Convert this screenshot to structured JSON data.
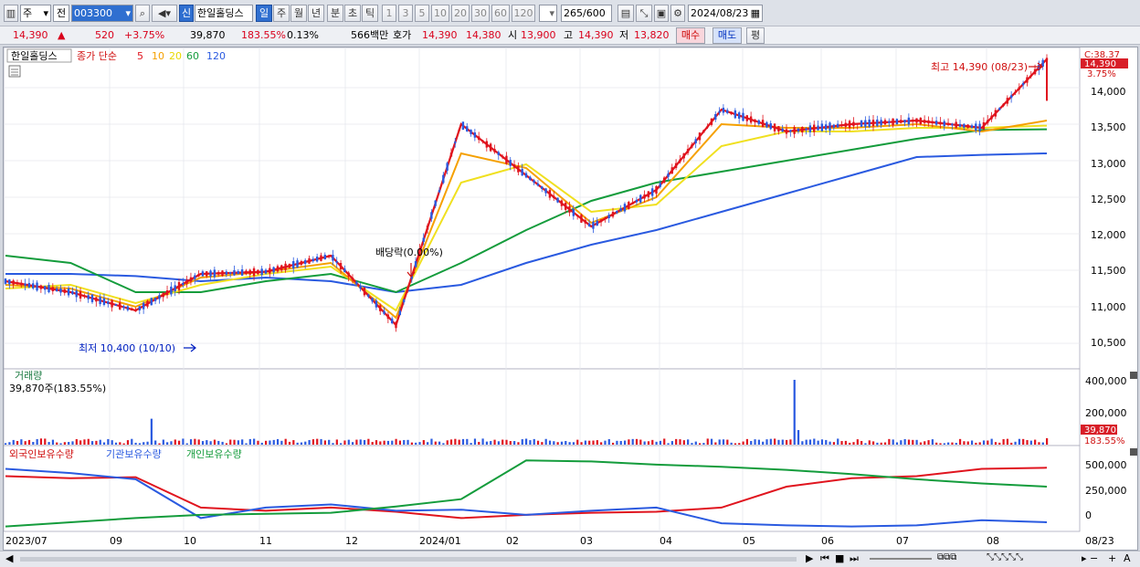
{
  "toolbar": {
    "period_unit": "주",
    "prev_label": "전",
    "stock_code": "003300",
    "new_badge": "신",
    "stock_name": "한일홀딩스",
    "timeframes": [
      "일",
      "주",
      "월",
      "년",
      "분",
      "초",
      "틱"
    ],
    "active_timeframe": "일",
    "intervals": [
      "1",
      "3",
      "5",
      "10",
      "20",
      "30",
      "60",
      "120"
    ],
    "count_current": "265",
    "count_total": "/600",
    "date": "2024/08/23"
  },
  "quote": {
    "price": "14,390",
    "change_arrow": "▲",
    "change": "520",
    "change_pct": "+3.75%",
    "volume": "39,870",
    "volume_ratio": "183.55%",
    "turnover_pct": "0.13%",
    "trade_value": "566백만",
    "bidask_label": "호가",
    "ask": "14,390",
    "bid": "14,380",
    "open_label": "시",
    "open": "13,900",
    "high_label": "고",
    "high": "14,390",
    "low_label": "저",
    "low": "13,820",
    "buy_button": "매수",
    "sell_button": "매도",
    "eval_button": "평"
  },
  "price_panel": {
    "stock_label": "한일홀딩스",
    "ma_title": "종가 단순",
    "ma_periods": [
      "5",
      "10",
      "20",
      "60",
      "120"
    ],
    "ma_colors": [
      "#e0141e",
      "#f5a000",
      "#f0e020",
      "#149c3c",
      "#2a5ae0"
    ],
    "y_ticks": [
      "14,000",
      "13,500",
      "13,000",
      "12,500",
      "12,000",
      "11,500",
      "11,000",
      "10,500"
    ],
    "ceiling_label": "C:38.37",
    "price_tag": "14,390",
    "pct_tag": "3.75%",
    "high_annotation": "최고 14,390 (08/23)",
    "low_annotation": "최저 10,400 (10/10)",
    "dividend_annotation": "배당락(0.00%)"
  },
  "volume_panel": {
    "title": "거래량",
    "value_label": "39,870주(183.55%)",
    "y_ticks": [
      "400,000",
      "200,000"
    ],
    "value_tag": "39,870",
    "pct_tag": "183.55%"
  },
  "holdings_panel": {
    "legend": [
      "외국인보유수량",
      "기관보유수량",
      "개인보유수량"
    ],
    "legend_colors": [
      "#e0141e",
      "#2a5ae0",
      "#149c3c"
    ],
    "y_ticks": [
      "500,000",
      "250,000",
      "0"
    ]
  },
  "x_axis": {
    "labels": [
      "2023/07",
      "09",
      "10",
      "11",
      "12",
      "2024/01",
      "02",
      "03",
      "04",
      "05",
      "06",
      "07",
      "08"
    ],
    "right_label": "08/23"
  },
  "chart_data": {
    "type": "line",
    "price_ylim": [
      10200,
      14500
    ],
    "price_ma": [
      {
        "name": "5",
        "x": [
          0,
          10,
          20,
          30,
          40,
          50,
          60,
          70,
          80,
          90,
          100
        ],
        "values": [
          11350,
          11200,
          10950,
          11450,
          11480,
          11700,
          10750,
          13500,
          12800,
          12100,
          12600,
          13700,
          13400,
          13500,
          13550,
          13450,
          14390
        ]
      },
      {
        "name": "10",
        "values": [
          11300,
          11250,
          11000,
          11400,
          11480,
          11600,
          10850,
          13100,
          12900,
          12150,
          12500,
          13500,
          13450,
          13450,
          13500,
          13400,
          13550
        ]
      },
      {
        "name": "20",
        "values": [
          11250,
          11300,
          11050,
          11300,
          11450,
          11550,
          10950,
          12700,
          12950,
          12300,
          12400,
          13200,
          13400,
          13400,
          13450,
          13450,
          13480
        ]
      },
      {
        "name": "60",
        "values": [
          11700,
          11600,
          11200,
          11200,
          11350,
          11450,
          11200,
          11600,
          12050,
          12450,
          12700,
          12850,
          13000,
          13150,
          13300,
          13420,
          13430
        ]
      },
      {
        "name": "120",
        "values": [
          11450,
          11450,
          11420,
          11350,
          11400,
          11350,
          11200,
          11300,
          11600,
          11850,
          12050,
          12300,
          12550,
          12800,
          13050,
          13080,
          13100
        ]
      }
    ],
    "volume": {
      "max_tick": 400000,
      "peak": 400000,
      "last": 39870
    },
    "holdings": [
      {
        "name": "외국인보유수량",
        "values": [
          450000,
          430000,
          440000,
          150000,
          120000,
          150000,
          110000,
          50000,
          80000,
          100000,
          110000,
          150000,
          350000,
          430000,
          450000,
          520000,
          530000
        ]
      },
      {
        "name": "기관보유수량",
        "values": [
          520000,
          480000,
          420000,
          50000,
          150000,
          180000,
          120000,
          130000,
          80000,
          120000,
          150000,
          0,
          -20000,
          -30000,
          -20000,
          30000,
          10000
        ]
      },
      {
        "name": "개인보유수량",
        "values": [
          -30000,
          10000,
          50000,
          80000,
          90000,
          100000,
          160000,
          230000,
          600000,
          590000,
          560000,
          540000,
          510000,
          470000,
          420000,
          380000,
          350000
        ]
      }
    ]
  }
}
